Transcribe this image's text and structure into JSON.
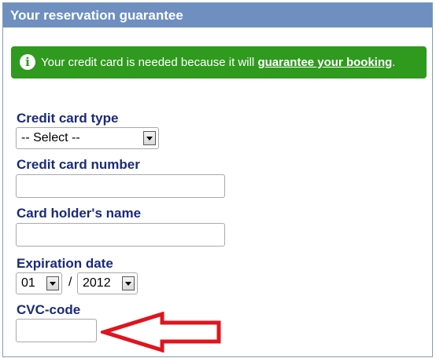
{
  "header": {
    "title": "Your reservation guarantee"
  },
  "notice": {
    "text": "Your credit card is needed because it will ",
    "link": "guarantee your booking",
    "suffix": "."
  },
  "form": {
    "card_type": {
      "label": "Credit card type",
      "value": "-- Select --"
    },
    "card_number": {
      "label": "Credit card number",
      "value": ""
    },
    "holder_name": {
      "label": "Card holder's name",
      "value": ""
    },
    "expiration": {
      "label": "Expiration date",
      "month": "01",
      "separator": "/",
      "year": "2012"
    },
    "cvc": {
      "label": "CVC-code",
      "value": ""
    }
  },
  "colors": {
    "header_bg": "#6e8fc0",
    "notice_bg": "#2f9a1e",
    "label": "#1a2a7a",
    "annotation_arrow": "#e0141e"
  },
  "icons": {
    "info": "info-circle-icon",
    "annotation": "red-arrow-icon"
  }
}
